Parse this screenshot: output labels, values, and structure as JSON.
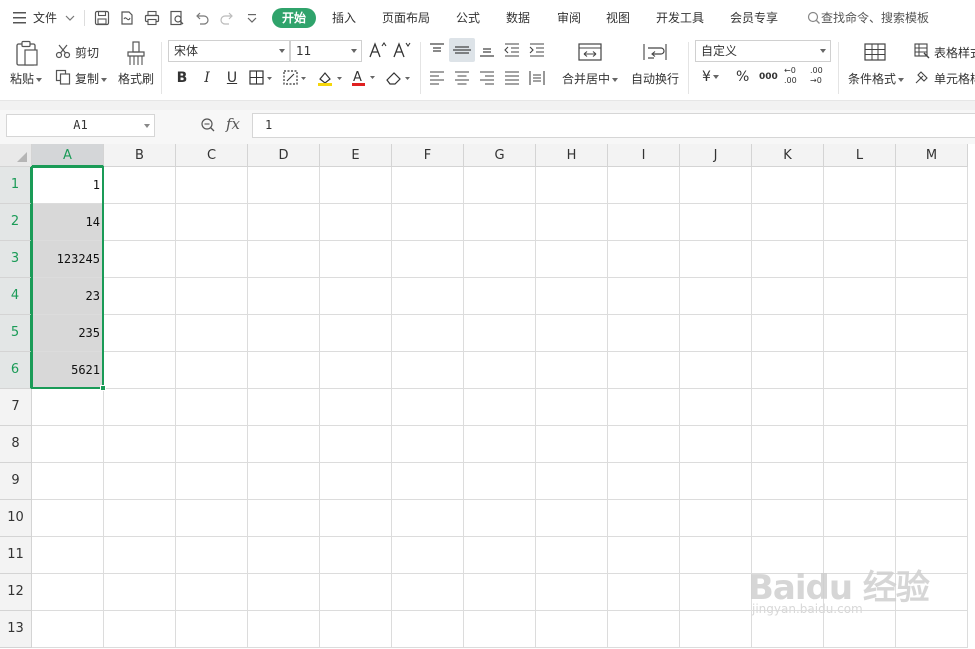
{
  "menubar": {
    "file_label": "文件",
    "tabs": [
      "开始",
      "插入",
      "页面布局",
      "公式",
      "数据",
      "审阅",
      "视图",
      "开发工具",
      "会员专享"
    ],
    "search_text": "查找命令、搜索模板"
  },
  "ribbon": {
    "paste_label": "粘贴",
    "cut_label": "剪切",
    "copy_label": "复制",
    "format_painter_label": "格式刷",
    "font_name": "宋体",
    "font_size": "11",
    "bold": "B",
    "italic": "I",
    "underline": "U",
    "font_color_glyph": "A",
    "merge_center_label": "合并居中",
    "wrap_text_label": "自动换行",
    "number_format": "自定义",
    "currency_glyph": "¥",
    "percent_glyph": "%",
    "thousands_glyph": "000",
    "dec_inc_glyph": "←0 .00",
    "dec_dec_glyph": ".00 →0",
    "conditional_format_label": "条件格式",
    "table_style_label": "表格样式",
    "cell_style_label": "单元格样式"
  },
  "formula_bar": {
    "name_box": "A1",
    "fx_label": "fx",
    "value": "1"
  },
  "grid": {
    "columns": [
      "A",
      "B",
      "C",
      "D",
      "E",
      "F",
      "G",
      "H",
      "I",
      "J",
      "K",
      "L",
      "M"
    ],
    "rows": [
      "1",
      "2",
      "3",
      "4",
      "5",
      "6",
      "7",
      "8",
      "9",
      "10",
      "11",
      "12",
      "13"
    ],
    "column_a_values": [
      "1",
      "14",
      "123245",
      "23",
      "235",
      "5621"
    ]
  },
  "watermark": {
    "brand": "Baidu 经验",
    "url": "jingyan.baidu.com"
  },
  "colors": {
    "accent_green": "#1a9b57",
    "active_tab_bg": "#2fa36b",
    "selection_fill": "#d8d8d8"
  }
}
